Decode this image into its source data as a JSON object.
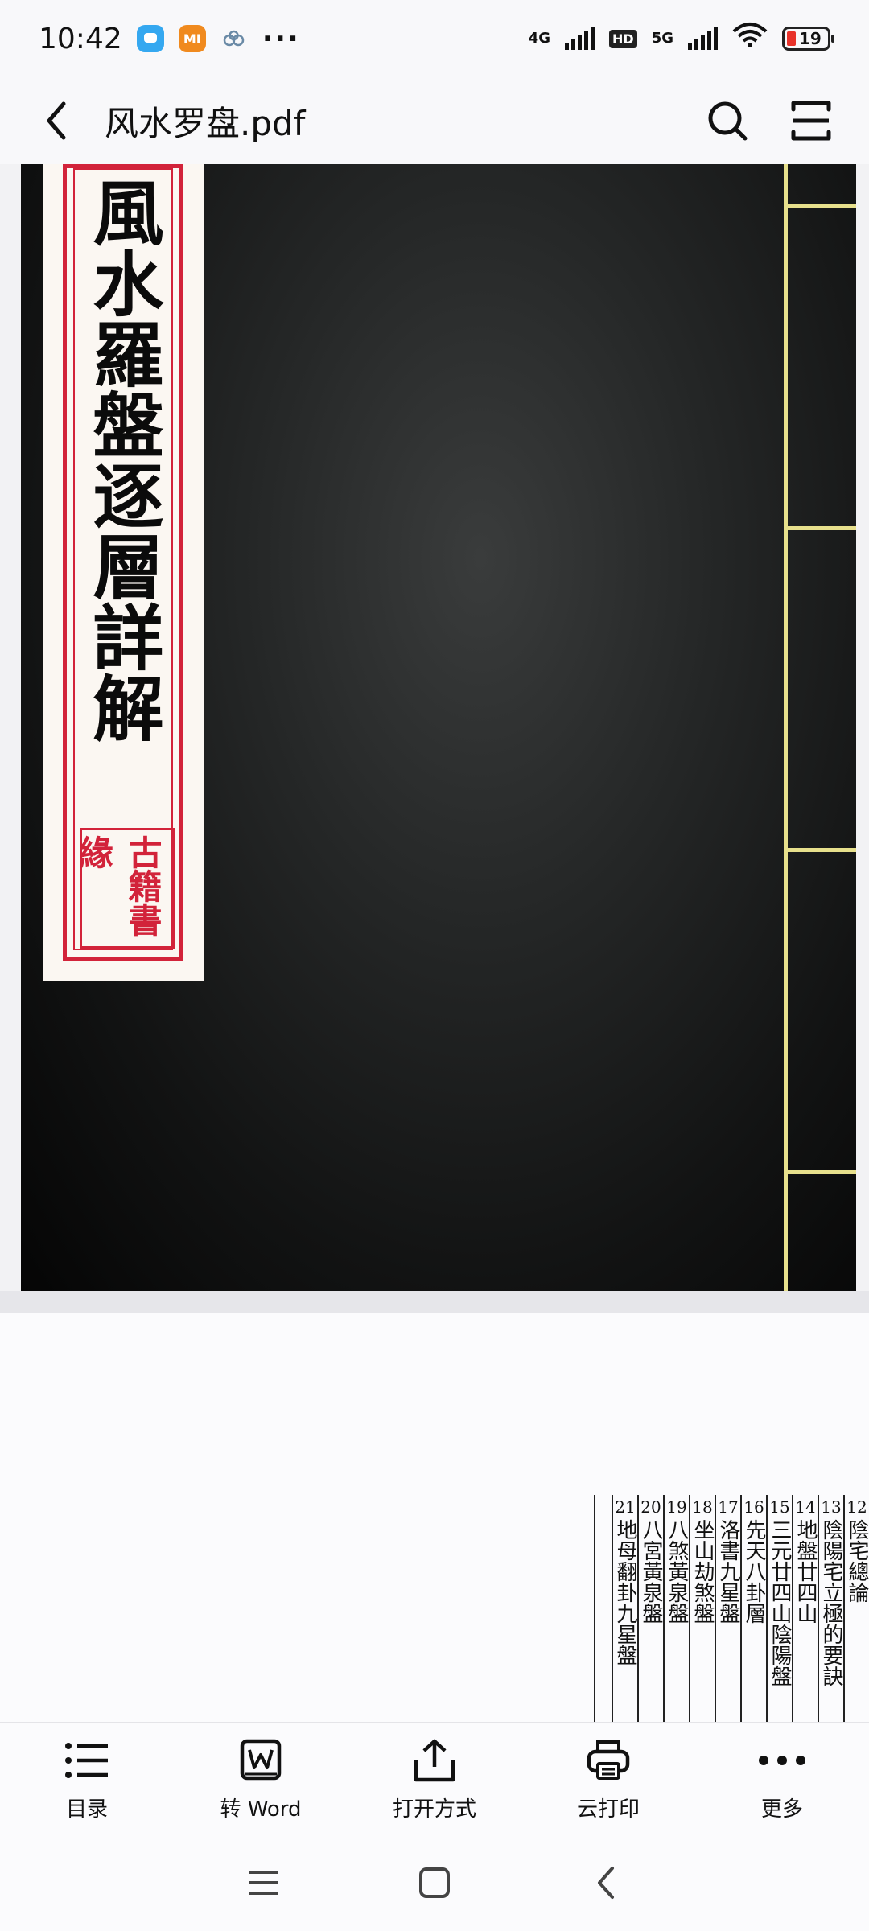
{
  "status_bar": {
    "time": "10:42",
    "app_icons": [
      "blue-chat-app",
      "mi-app"
    ],
    "mi_label": "MI",
    "more": "···",
    "sim1": "4G",
    "hd": "HD",
    "sim2": "5G",
    "battery": "19",
    "battery_level": 0.19,
    "battery_color": "#e8322a"
  },
  "app_bar": {
    "title": "风水罗盘.pdf"
  },
  "document": {
    "page1": {
      "title_text": "風水羅盤逐層詳解",
      "seal_text": "古籍書緣",
      "cover_color": "#141515",
      "slip_border_color": "#d2233a"
    },
    "page2": {
      "toc": [
        {
          "num": "12",
          "text": "陰宅總論"
        },
        {
          "num": "13",
          "text": "陰陽宅立極的要訣"
        },
        {
          "num": "14",
          "text": "地盤廿四山"
        },
        {
          "num": "15",
          "text": "三元廿四山陰陽盤"
        },
        {
          "num": "16",
          "text": "先天八卦層"
        },
        {
          "num": "17",
          "text": "洛書九星盤"
        },
        {
          "num": "18",
          "text": "坐山劫煞盤"
        },
        {
          "num": "19",
          "text": "八煞黃泉盤"
        },
        {
          "num": "20",
          "text": "八宮黃泉盤"
        },
        {
          "num": "21",
          "text": "地母翻卦九星盤"
        }
      ]
    }
  },
  "toolbar": {
    "items": [
      {
        "label": "目录",
        "icon": "list-icon"
      },
      {
        "label": "转 Word",
        "icon": "word-icon"
      },
      {
        "label": "打开方式",
        "icon": "share-icon"
      },
      {
        "label": "云打印",
        "icon": "printer-icon"
      },
      {
        "label": "更多",
        "icon": "more-icon"
      }
    ]
  }
}
